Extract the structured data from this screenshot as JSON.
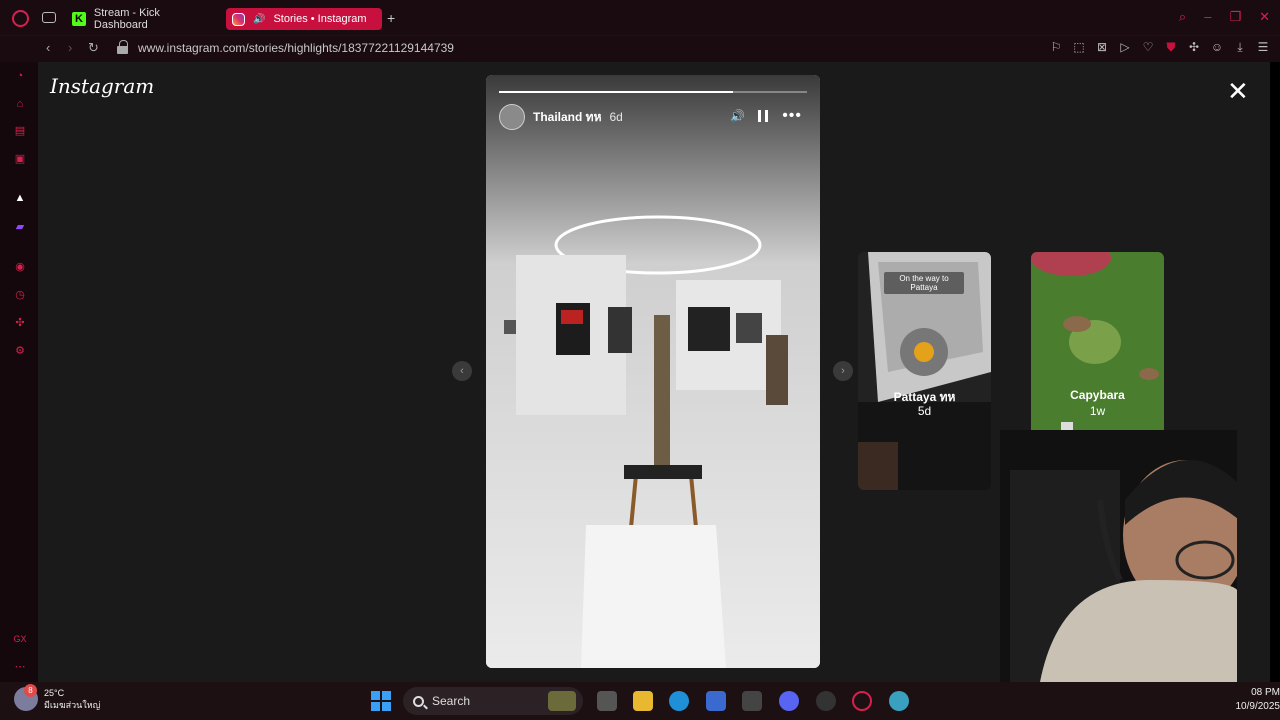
{
  "browser": {
    "tabs": [
      {
        "label": "Stream - Kick Dashboard",
        "icon": "kick-icon"
      },
      {
        "label": "Stories • Instagram",
        "icon": "instagram-icon",
        "active": true
      }
    ],
    "url": "www.instagram.com/stories/highlights/18377221129144739",
    "kick_letter": "K"
  },
  "instagram": {
    "logo": "Instagram",
    "story": {
      "username": "Thailand ทห",
      "time": "6d",
      "progress": 0.76
    },
    "previews": [
      {
        "title": "Pattaya ทห",
        "time": "5d",
        "caption": "On the way to Pattaya"
      },
      {
        "title": "Capybara",
        "time": "1w"
      }
    ]
  },
  "taskbar": {
    "weather_temp": "25°C",
    "weather_desc": "มีเมฆส่วนใหญ่",
    "weather_badge": "8",
    "search_label": "Search",
    "time": "08 PM",
    "date": "10/9/2025"
  },
  "colors": {
    "accent": "#c8103f",
    "kick_green": "#53fc18"
  }
}
